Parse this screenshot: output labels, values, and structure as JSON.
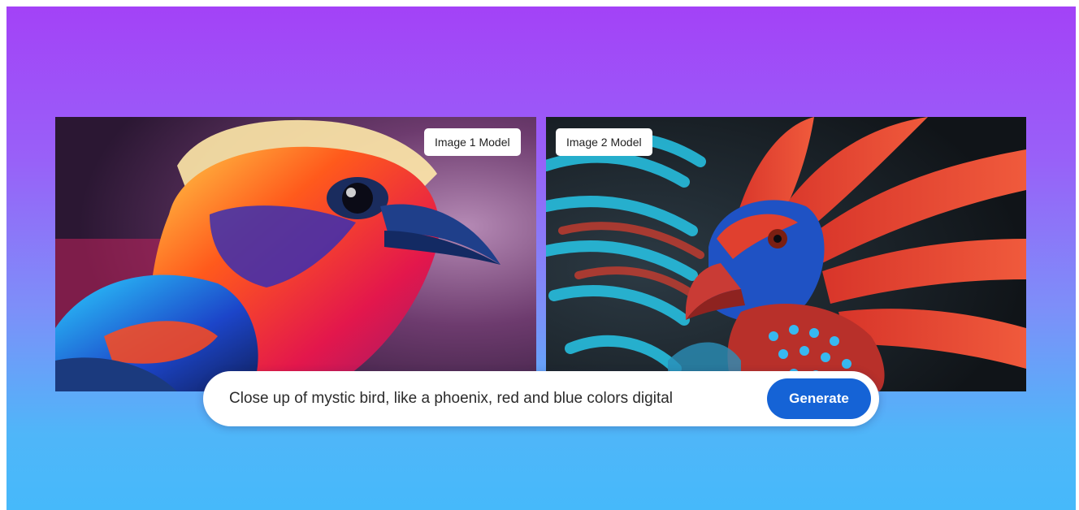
{
  "images": [
    {
      "label": "Image 1 Model",
      "icon": "bird-illustration"
    },
    {
      "label": "Image 2 Model",
      "icon": "phoenix-illustration"
    }
  ],
  "prompt": {
    "value": "Close up of mystic bird, like a phoenix, red and blue colors digital",
    "button_label": "Generate"
  },
  "colors": {
    "gradient_top": "#a342f7",
    "gradient_bottom": "#46b9fa",
    "button": "#1563d6"
  }
}
